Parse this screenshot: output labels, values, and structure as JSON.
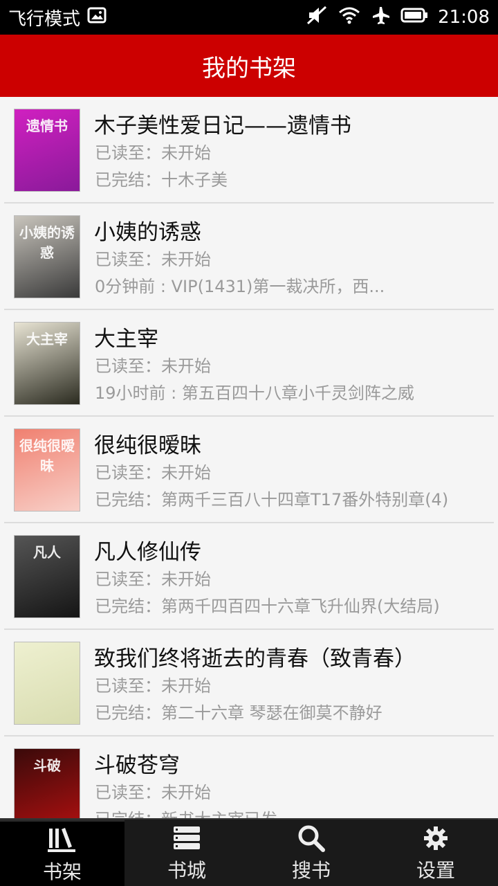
{
  "status_bar": {
    "airplane_mode_label": "飞行模式",
    "time": "21:08",
    "icons": [
      "image-icon",
      "mute-icon",
      "wifi-icon",
      "airplane-icon",
      "battery-icon"
    ]
  },
  "header": {
    "title": "我的书架"
  },
  "accent_color": "#cc0000",
  "books": [
    {
      "title": "木子美性爱日记——遗情书",
      "read_status": "已读至：未开始",
      "update_info": "已完结：十木子美",
      "cover_colors": [
        "#d020c0",
        "#8a1a9a"
      ],
      "cover_text": "遗情书"
    },
    {
      "title": "小姨的诱惑",
      "read_status": "已读至：未开始",
      "update_info": "0分钟前 : VIP(1431)第一裁决所，西...",
      "cover_colors": [
        "#c8c4bc",
        "#3a3a3a"
      ],
      "cover_text": "小姨的诱惑"
    },
    {
      "title": "大主宰",
      "read_status": "已读至：未开始",
      "update_info": "19小时前 : 第五百四十八章小千灵剑阵之威",
      "cover_colors": [
        "#e8e4d4",
        "#2b2b20"
      ],
      "cover_text": "大主宰"
    },
    {
      "title": "很纯很暧昧",
      "read_status": "已读至：未开始",
      "update_info": "已完结：第两千三百八十四章T17番外特别章(4)",
      "cover_colors": [
        "#f08070",
        "#f8d0c8"
      ],
      "cover_text": "很纯很暧昧"
    },
    {
      "title": "凡人修仙传",
      "read_status": "已读至：未开始",
      "update_info": "已完结：第两千四百四十六章飞升仙界(大结局)",
      "cover_colors": [
        "#555555",
        "#151515"
      ],
      "cover_text": "凡人"
    },
    {
      "title": "致我们终将逝去的青春（致青春）",
      "read_status": "已读至：未开始",
      "update_info": "已完结：第二十六章 琴瑟在御莫不静好",
      "cover_colors": [
        "#eef0d0",
        "#d8dcb0"
      ],
      "cover_text": ""
    },
    {
      "title": "斗破苍穹",
      "read_status": "已读至：未开始",
      "update_info": "已完结：新书大主宰已发",
      "cover_colors": [
        "#3a0a0a",
        "#b01010"
      ],
      "cover_text": "斗破"
    }
  ],
  "bottom_nav": [
    {
      "label": "书架",
      "icon": "bookshelf-icon",
      "active": true
    },
    {
      "label": "书城",
      "icon": "bookstore-icon",
      "active": false
    },
    {
      "label": "搜书",
      "icon": "search-icon",
      "active": false
    },
    {
      "label": "设置",
      "icon": "gear-icon",
      "active": false
    }
  ]
}
